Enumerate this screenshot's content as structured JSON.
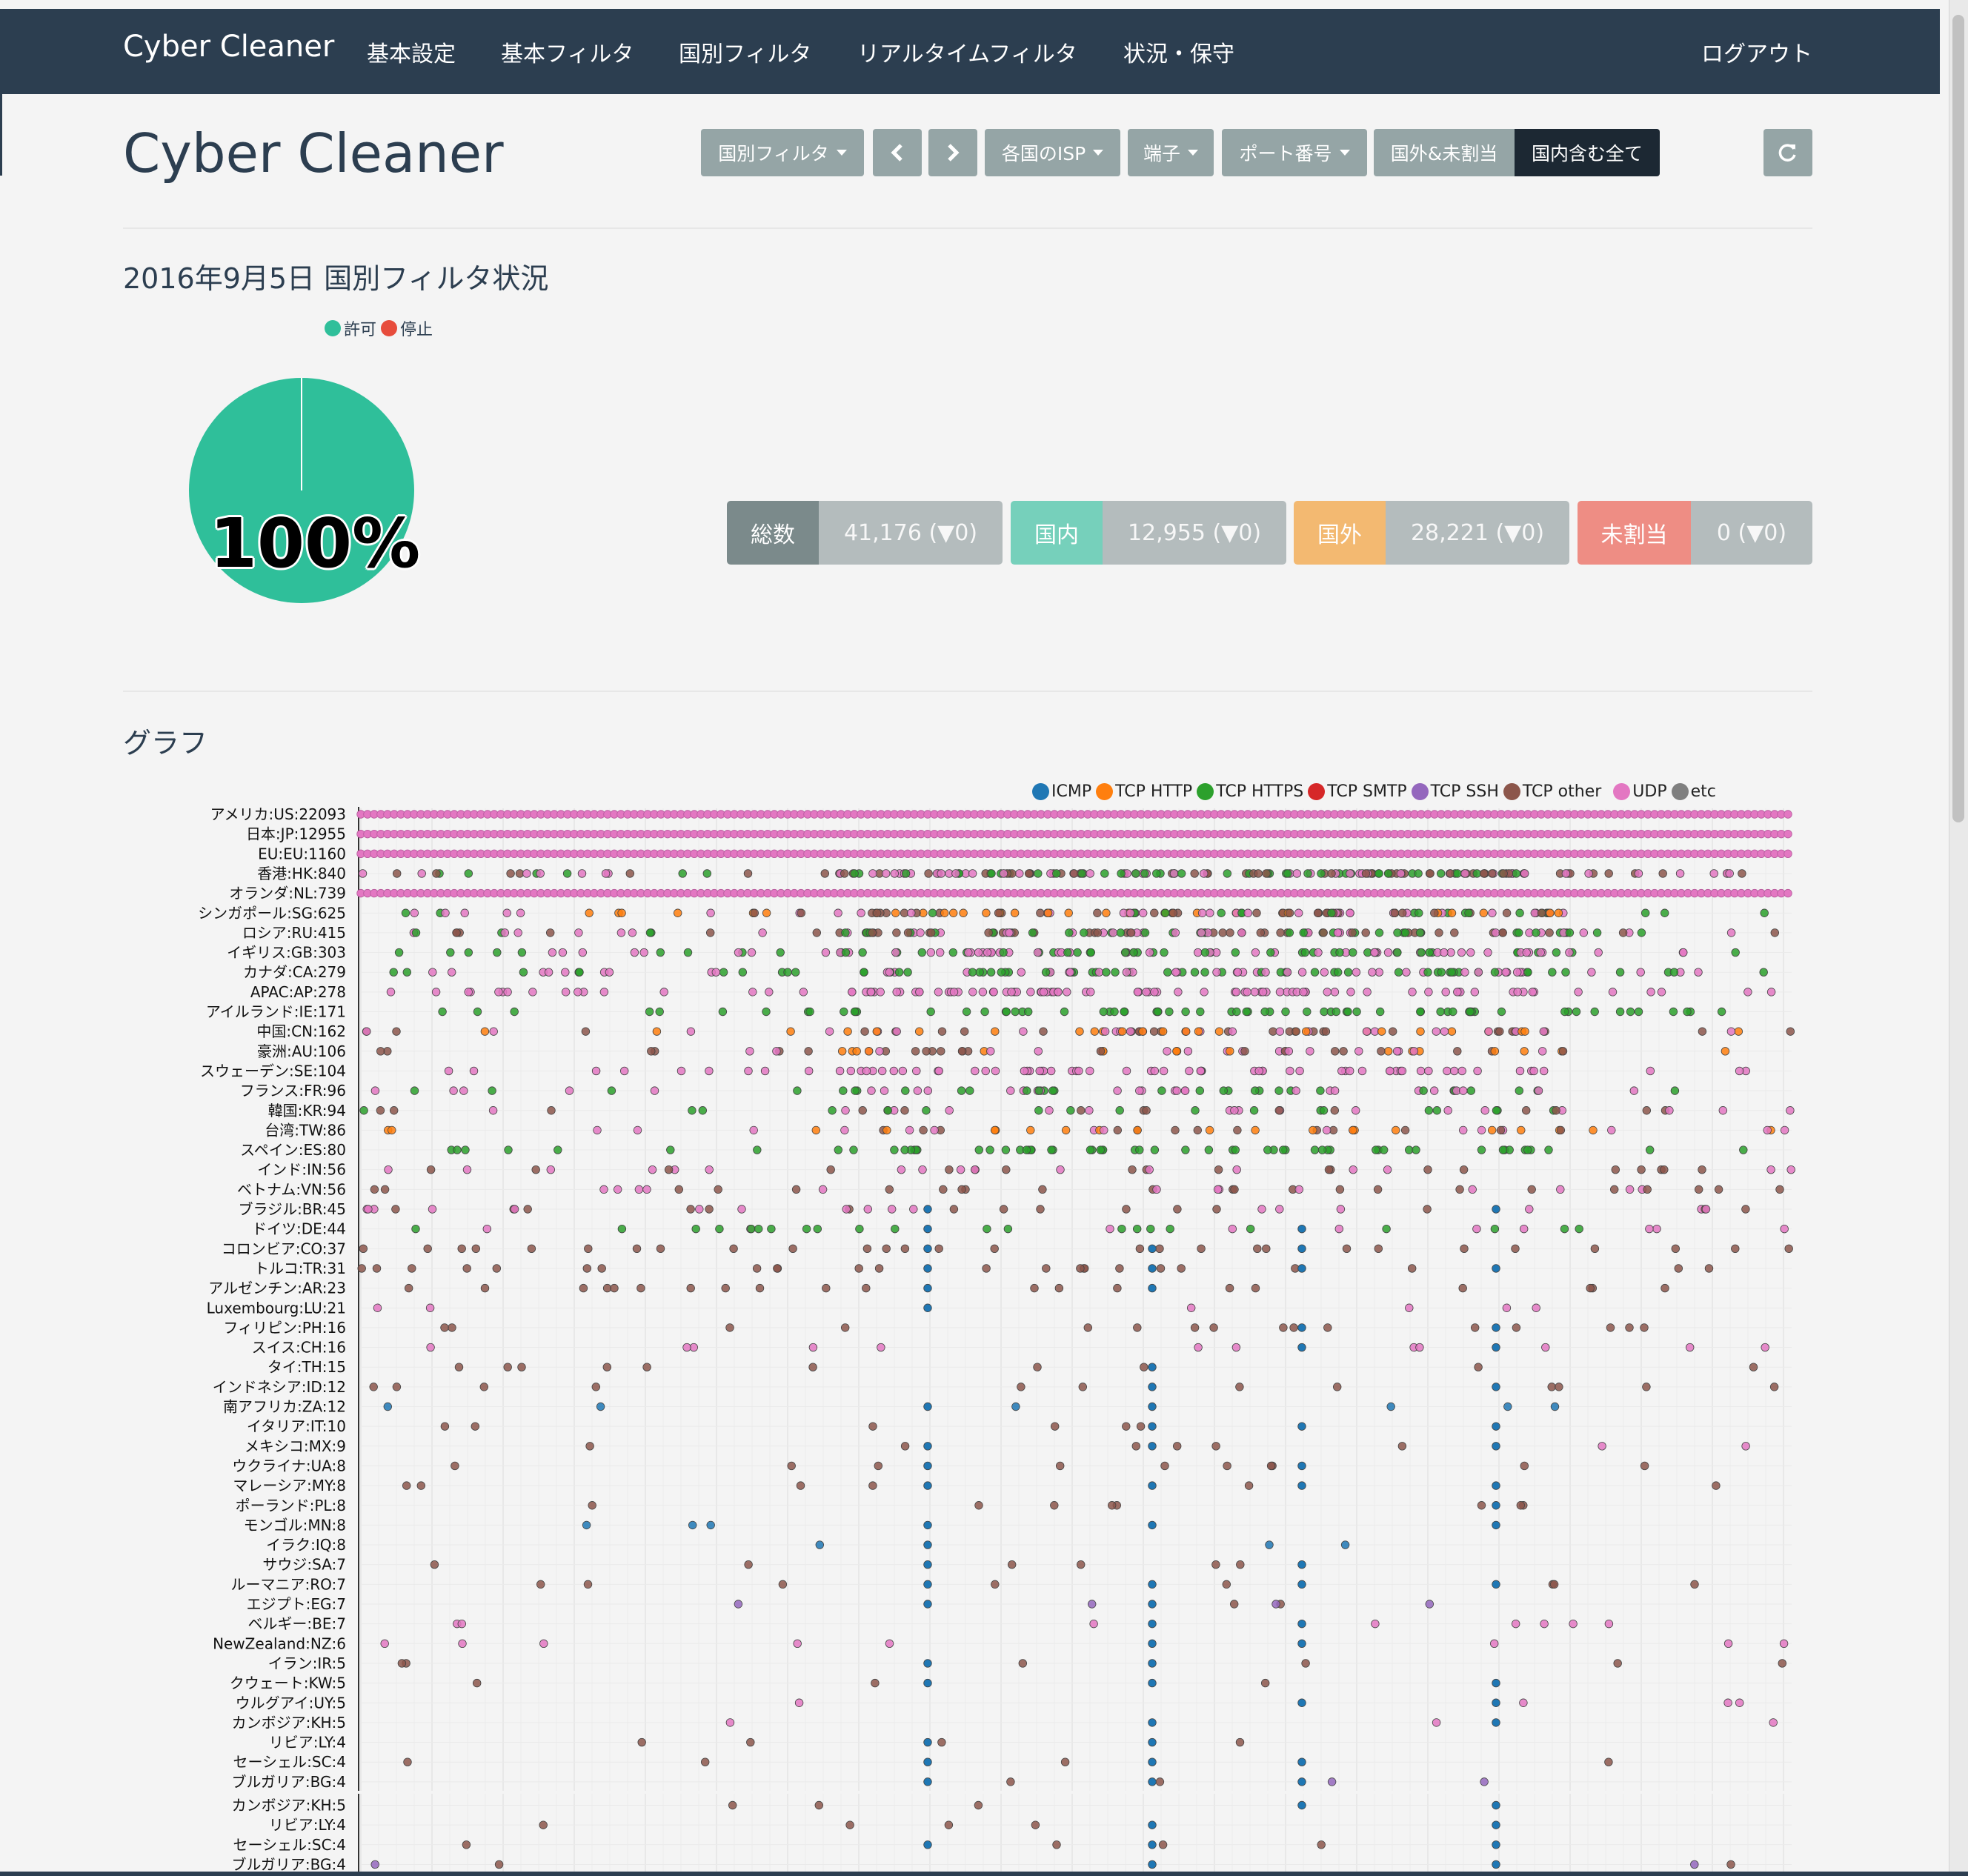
{
  "nav": {
    "brand": "Cyber Cleaner",
    "items": [
      "基本設定",
      "基本フィルタ",
      "国別フィルタ",
      "リアルタイムフィルタ",
      "状況・保守"
    ],
    "logout": "ログアウト"
  },
  "header": {
    "title": "Cyber Cleaner",
    "toolbar": {
      "country_filter": "国別フィルタ",
      "prev_icon": "chevron-left-icon",
      "next_icon": "chevron-right-icon",
      "isp": "各国のISP",
      "terminal": "端子",
      "port": "ポート番号",
      "overseas": "国外&未割当",
      "all": "国内含む全て",
      "refresh_icon": "refresh-icon"
    }
  },
  "status": {
    "title": "2016年9月5日 国別フィルタ状況",
    "legend": [
      {
        "label": "許可",
        "color": "#2fbf9a"
      },
      {
        "label": "停止",
        "color": "#e74c3c"
      }
    ],
    "pie_percent": "100%",
    "stats": [
      {
        "key": "総数",
        "value": "41,176 (▼0)",
        "color": "#7b8a8b"
      },
      {
        "key": "国内",
        "value": "12,955 (▼0)",
        "color": "#76d0bb"
      },
      {
        "key": "国外",
        "value": "28,221 (▼0)",
        "color": "#f3b971"
      },
      {
        "key": "未割当",
        "value": "0 (▼0)",
        "color": "#ee8d84"
      }
    ]
  },
  "graph": {
    "title": "グラフ",
    "legend": [
      {
        "label": "ICMP",
        "color": "#1f77b4"
      },
      {
        "label": "TCP HTTP",
        "color": "#ff7f0e"
      },
      {
        "label": "TCP HTTPS",
        "color": "#2ca02c"
      },
      {
        "label": "TCP SMTP",
        "color": "#d62728"
      },
      {
        "label": "TCP SSH",
        "color": "#9467bd"
      },
      {
        "label": "TCP other",
        "color": "#8c564b"
      },
      {
        "label": "UDP",
        "color": "#e377c2"
      },
      {
        "label": "etc",
        "color": "#7f7f7f"
      }
    ]
  },
  "chart_data": {
    "type": "scatter",
    "title": "",
    "xlabel": "",
    "ylabel": "",
    "grid": true,
    "legend_position": "top-right",
    "rows": [
      {
        "label": "アメリカ:US:22093",
        "density": 1.0,
        "series": [
          "UDP"
        ]
      },
      {
        "label": "日本:JP:12955",
        "density": 1.0,
        "series": [
          "UDP"
        ]
      },
      {
        "label": "EU:EU:1160",
        "density": 0.95,
        "series": [
          "UDP"
        ]
      },
      {
        "label": "香港:HK:840",
        "density": 0.85,
        "series": [
          "UDP",
          "TCP HTTPS",
          "TCP other"
        ]
      },
      {
        "label": "オランダ:NL:739",
        "density": 0.9,
        "series": [
          "UDP"
        ]
      },
      {
        "label": "シンガポール:SG:625",
        "density": 0.6,
        "series": [
          "UDP",
          "TCP HTTP",
          "TCP other",
          "TCP HTTPS"
        ]
      },
      {
        "label": "ロシア:RU:415",
        "density": 0.65,
        "series": [
          "TCP HTTPS",
          "TCP other",
          "UDP"
        ]
      },
      {
        "label": "イギリス:GB:303",
        "density": 0.55,
        "series": [
          "UDP",
          "TCP HTTPS"
        ]
      },
      {
        "label": "カナダ:CA:279",
        "density": 0.55,
        "series": [
          "UDP",
          "TCP HTTPS"
        ]
      },
      {
        "label": "APAC:AP:278",
        "density": 0.5,
        "series": [
          "UDP"
        ]
      },
      {
        "label": "アイルランド:IE:171",
        "density": 0.35,
        "series": [
          "TCP HTTPS"
        ]
      },
      {
        "label": "中国:CN:162",
        "density": 0.4,
        "series": [
          "TCP other",
          "TCP HTTP",
          "UDP"
        ]
      },
      {
        "label": "豪洲:AU:106",
        "density": 0.3,
        "series": [
          "UDP",
          "TCP HTTP",
          "TCP other"
        ]
      },
      {
        "label": "スウェーデン:SE:104",
        "density": 0.35,
        "series": [
          "UDP"
        ]
      },
      {
        "label": "フランス:FR:96",
        "density": 0.3,
        "series": [
          "TCP HTTPS",
          "UDP"
        ]
      },
      {
        "label": "韓国:KR:94",
        "density": 0.25,
        "series": [
          "TCP other",
          "UDP",
          "TCP HTTPS"
        ]
      },
      {
        "label": "台湾:TW:86",
        "density": 0.25,
        "series": [
          "TCP other",
          "TCP HTTP",
          "UDP"
        ]
      },
      {
        "label": "スペイン:ES:80",
        "density": 0.3,
        "series": [
          "TCP HTTPS"
        ]
      },
      {
        "label": "インド:IN:56",
        "density": 0.18,
        "series": [
          "TCP other",
          "UDP"
        ]
      },
      {
        "label": "ベトナム:VN:56",
        "density": 0.18,
        "series": [
          "TCP other",
          "UDP"
        ]
      },
      {
        "label": "ブラジル:BR:45",
        "density": 0.16,
        "series": [
          "TCP other",
          "UDP"
        ]
      },
      {
        "label": "ドイツ:DE:44",
        "density": 0.16,
        "series": [
          "UDP",
          "TCP HTTPS"
        ]
      },
      {
        "label": "コロンビア:CO:37",
        "density": 0.14,
        "series": [
          "TCP other"
        ]
      },
      {
        "label": "トルコ:TR:31",
        "density": 0.12,
        "series": [
          "TCP other"
        ]
      },
      {
        "label": "アルゼンチン:AR:23",
        "density": 0.1,
        "series": [
          "TCP other"
        ]
      },
      {
        "label": "Luxembourg:LU:21",
        "density": 0.03,
        "series": [
          "UDP"
        ]
      },
      {
        "label": "フィリピン:PH:16",
        "density": 0.08,
        "series": [
          "TCP other"
        ]
      },
      {
        "label": "スイス:CH:16",
        "density": 0.06,
        "series": [
          "UDP"
        ]
      },
      {
        "label": "タイ:TH:15",
        "density": 0.05,
        "series": [
          "TCP other"
        ]
      },
      {
        "label": "インドネシア:ID:12",
        "density": 0.06,
        "series": [
          "TCP other"
        ]
      },
      {
        "label": "南アフリカ:ZA:12",
        "density": 0.03,
        "series": [
          "ICMP"
        ]
      },
      {
        "label": "イタリア:IT:10",
        "density": 0.03,
        "series": [
          "TCP other"
        ]
      },
      {
        "label": "メキシコ:MX:9",
        "density": 0.04,
        "series": [
          "TCP other",
          "UDP"
        ]
      },
      {
        "label": "ウクライナ:UA:8",
        "density": 0.05,
        "series": [
          "TCP other"
        ]
      },
      {
        "label": "マレーシア:MY:8",
        "density": 0.03,
        "series": [
          "TCP other"
        ]
      },
      {
        "label": "ポーランド:PL:8",
        "density": 0.04,
        "series": [
          "TCP other"
        ]
      },
      {
        "label": "モンゴル:MN:8",
        "density": 0.0,
        "series": [
          "ICMP"
        ]
      },
      {
        "label": "イラク:IQ:8",
        "density": 0.0,
        "series": [
          "ICMP"
        ]
      },
      {
        "label": "サウジ:SA:7",
        "density": 0.03,
        "series": [
          "TCP other"
        ]
      },
      {
        "label": "ルーマニア:RO:7",
        "density": 0.04,
        "series": [
          "TCP other"
        ]
      },
      {
        "label": "エジプト:EG:7",
        "density": 0.03,
        "series": [
          "TCP other",
          "TCP SSH"
        ]
      },
      {
        "label": "ベルギー:BE:7",
        "density": 0.04,
        "series": [
          "UDP"
        ]
      },
      {
        "label": "NewZealand:NZ:6",
        "density": 0.04,
        "series": [
          "UDP"
        ]
      },
      {
        "label": "イラン:IR:5",
        "density": 0.03,
        "series": [
          "TCP other"
        ]
      },
      {
        "label": "クウェート:KW:5",
        "density": 0.01,
        "series": [
          "TCP other"
        ]
      },
      {
        "label": "ウルグアイ:UY:5",
        "density": 0.02,
        "series": [
          "UDP"
        ]
      },
      {
        "label": "カンボジア:KH:5",
        "density": 0.01,
        "series": [
          "UDP"
        ]
      },
      {
        "label": "リビア:LY:4",
        "density": 0.02,
        "series": [
          "TCP other"
        ]
      },
      {
        "label": "セーシェル:SC:4",
        "density": 0.02,
        "series": [
          "TCP other"
        ]
      },
      {
        "label": "ブルガリア:BG:4",
        "density": 0.02,
        "series": [
          "TCP other",
          "TCP SSH"
        ]
      },
      {
        "label": "カンボジア:KH:5",
        "density": 0.01,
        "series": [
          "TCP other"
        ]
      },
      {
        "label": "リビア:LY:4",
        "density": 0.02,
        "series": [
          "TCP other"
        ]
      },
      {
        "label": "セーシェル:SC:4",
        "density": 0.02,
        "series": [
          "TCP other"
        ]
      },
      {
        "label": "ブルガリア:BG:4",
        "density": 0.02,
        "series": [
          "TCP other",
          "TCP SSH"
        ]
      }
    ]
  }
}
